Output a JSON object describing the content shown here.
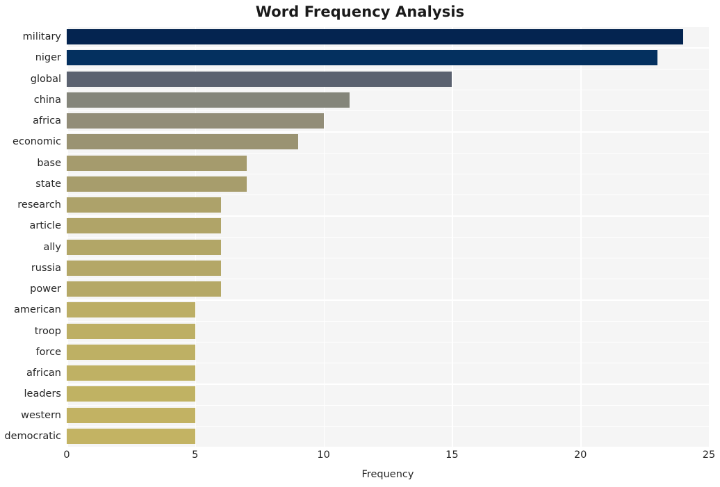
{
  "chart_data": {
    "type": "bar",
    "orientation": "horizontal",
    "title": "Word Frequency Analysis",
    "xlabel": "Frequency",
    "ylabel": "",
    "xlim": [
      0,
      25
    ],
    "xticks": [
      0,
      5,
      10,
      15,
      20,
      25
    ],
    "xtick_labels": [
      "0",
      "5",
      "10",
      "15",
      "20",
      "25"
    ],
    "grid": true,
    "legend": null,
    "categories": [
      "military",
      "niger",
      "global",
      "china",
      "africa",
      "economic",
      "base",
      "state",
      "research",
      "article",
      "ally",
      "russia",
      "power",
      "american",
      "troop",
      "force",
      "african",
      "leaders",
      "western",
      "democratic"
    ],
    "values": [
      24,
      23,
      15,
      11,
      10,
      9,
      7,
      7,
      6,
      6,
      6,
      6,
      6,
      5,
      5,
      5,
      5,
      5,
      5,
      5
    ],
    "bar_colors": [
      "#042450",
      "#04305f",
      "#5b6270",
      "#84857a",
      "#928d78",
      "#9a9372",
      "#a59b6d",
      "#a79d6c",
      "#ada26a",
      "#b0a468",
      "#b2a667",
      "#b4a767",
      "#b5a866",
      "#bcae65",
      "#bdaf64",
      "#beb064",
      "#bfb164",
      "#c0b263",
      "#c2b263",
      "#c3b363"
    ],
    "colors": {
      "plot_background": "#f5f5f5",
      "figure_background": "#ffffff",
      "gridline": "#ffffff",
      "text": "#262626",
      "title": "#1a1a1a"
    }
  }
}
